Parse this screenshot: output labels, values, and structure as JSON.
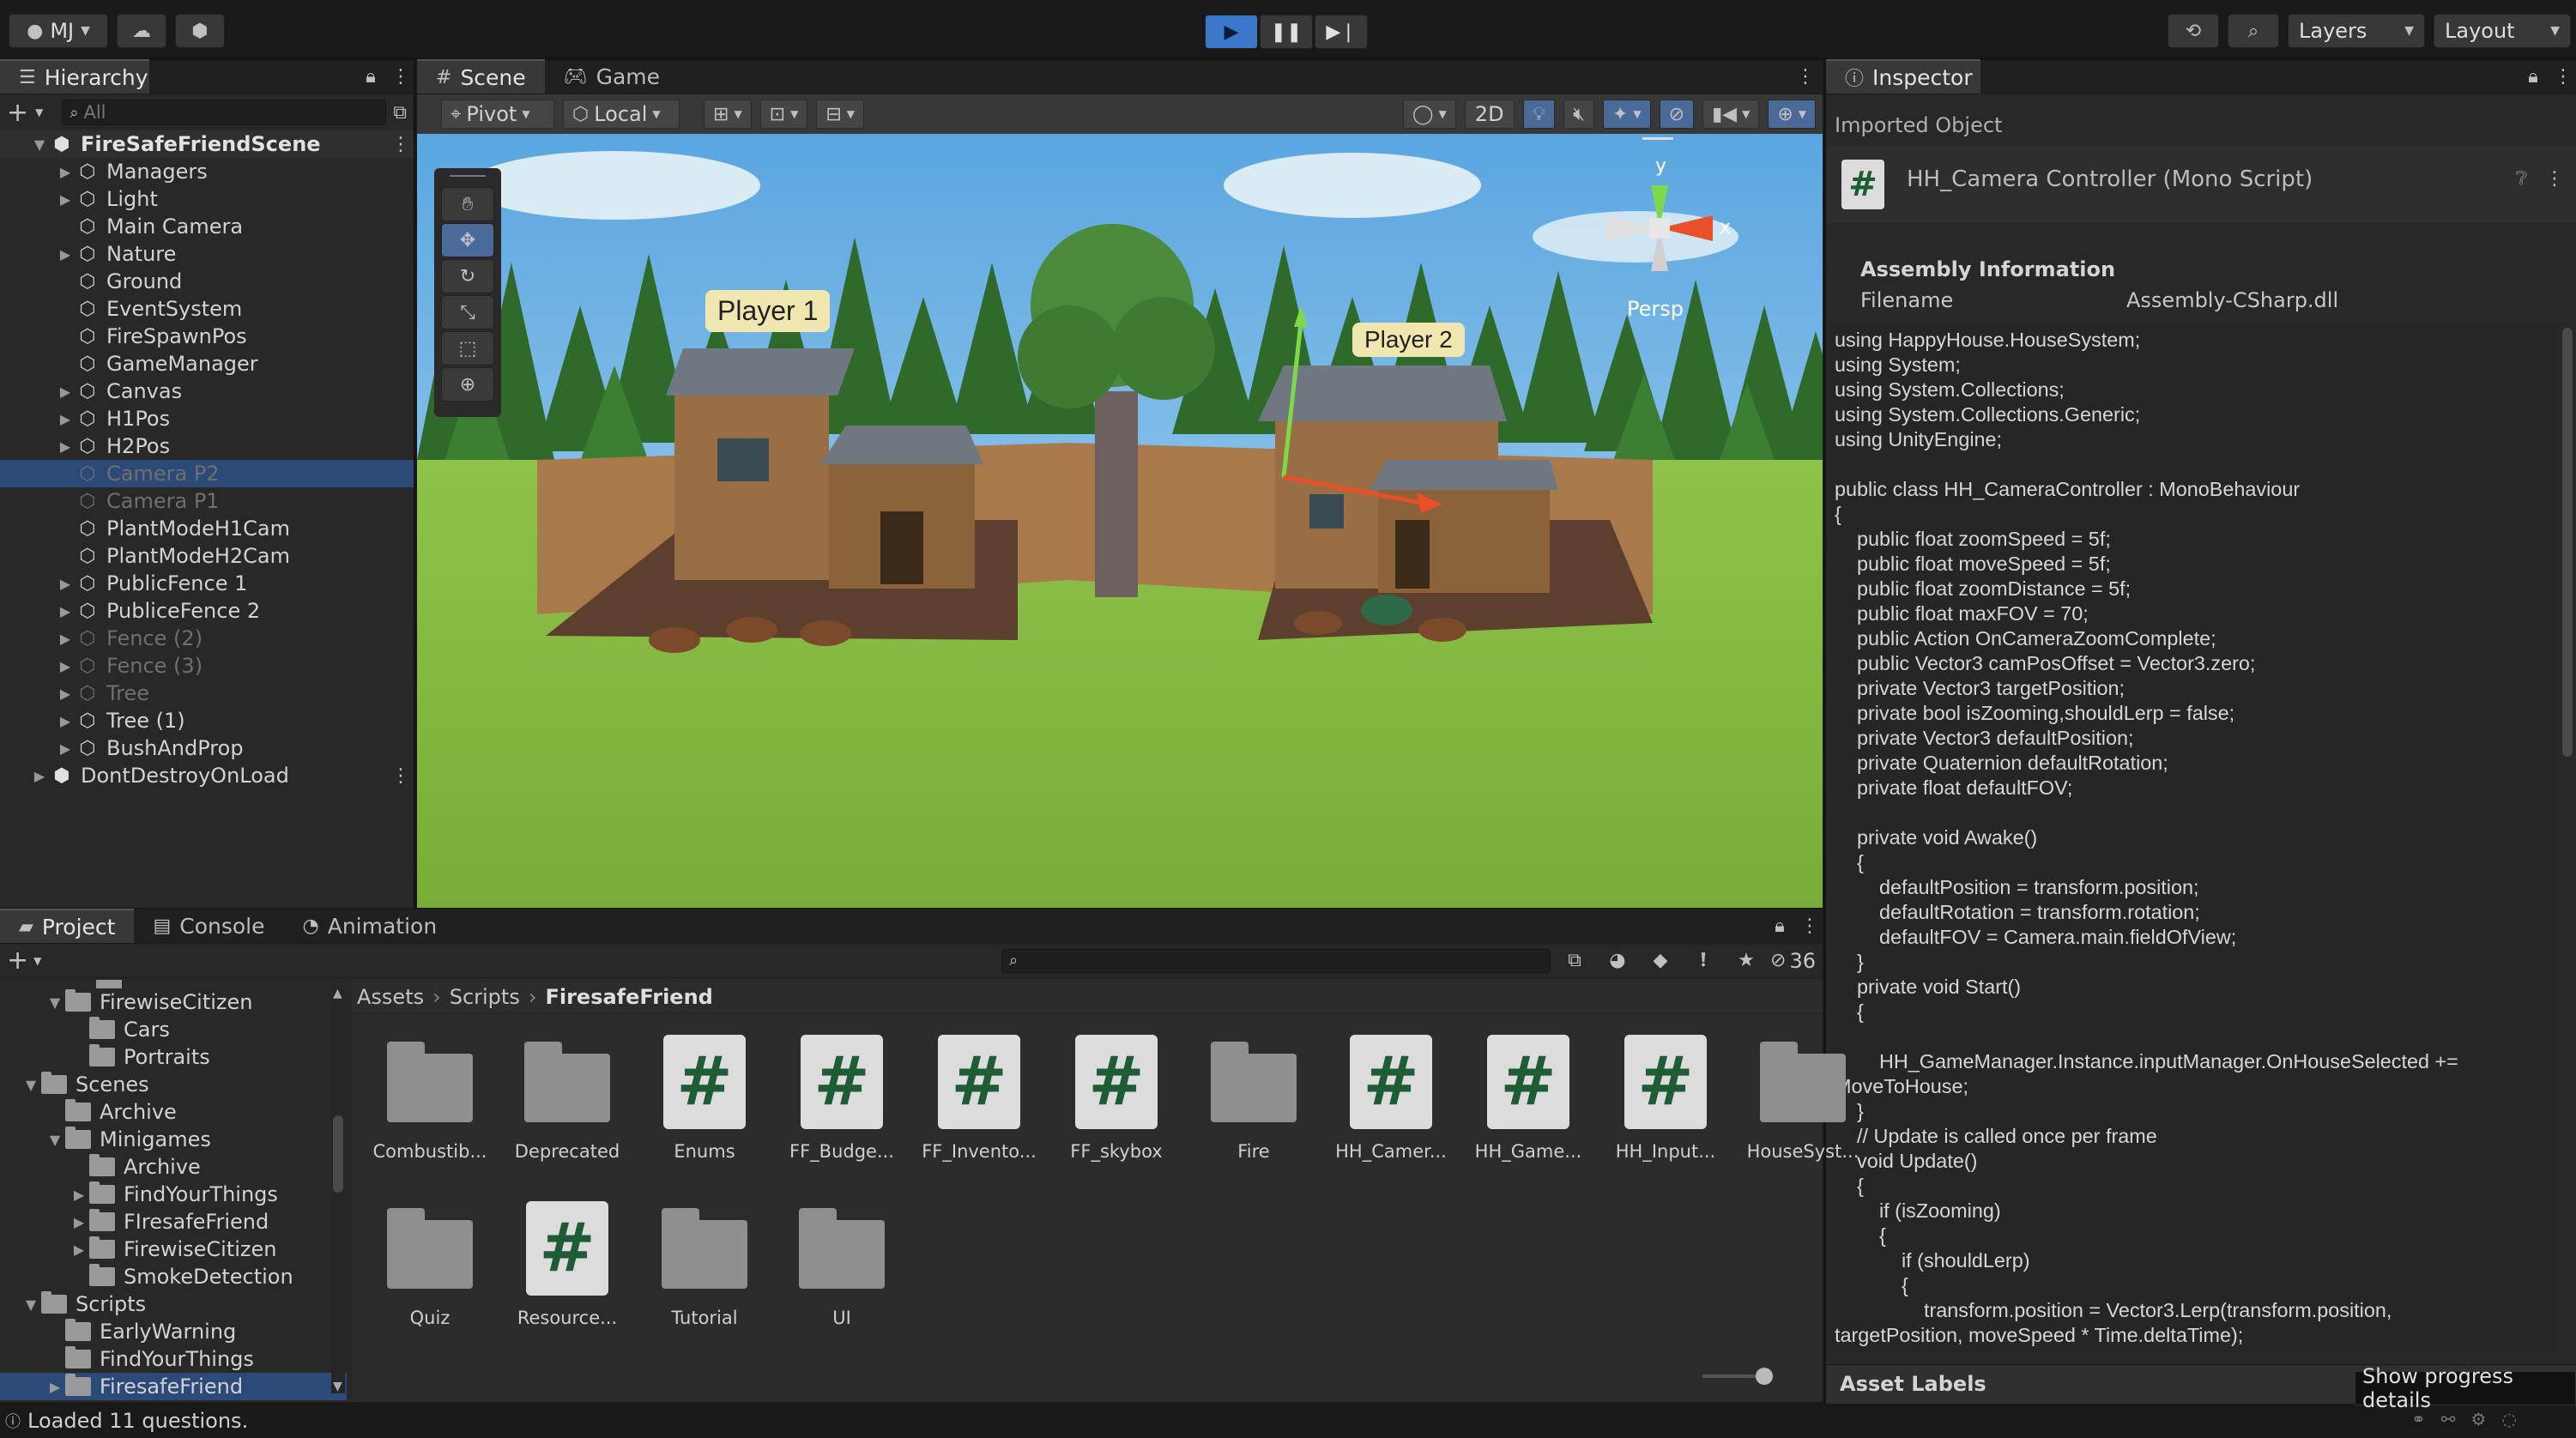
{
  "toolbar": {
    "account": "MJ",
    "layers_label": "Layers",
    "layout_label": "Layout"
  },
  "hierarchy": {
    "tab": "Hierarchy",
    "search_placeholder": "All",
    "scene_name": "FireSafeFriendScene",
    "items": [
      {
        "label": "Managers",
        "arrow": true,
        "dim": false,
        "sel": false
      },
      {
        "label": "Light",
        "arrow": true,
        "dim": false,
        "sel": false
      },
      {
        "label": "Main Camera",
        "arrow": false,
        "dim": false,
        "sel": false
      },
      {
        "label": "Nature",
        "arrow": true,
        "dim": false,
        "sel": false
      },
      {
        "label": "Ground",
        "arrow": false,
        "dim": false,
        "sel": false
      },
      {
        "label": "EventSystem",
        "arrow": false,
        "dim": false,
        "sel": false
      },
      {
        "label": "FireSpawnPos",
        "arrow": false,
        "dim": false,
        "sel": false
      },
      {
        "label": "GameManager",
        "arrow": false,
        "dim": false,
        "sel": false
      },
      {
        "label": "Canvas",
        "arrow": true,
        "dim": false,
        "sel": false
      },
      {
        "label": "H1Pos",
        "arrow": true,
        "dim": false,
        "sel": false
      },
      {
        "label": "H2Pos",
        "arrow": true,
        "dim": false,
        "sel": false
      },
      {
        "label": "Camera P2",
        "arrow": false,
        "dim": true,
        "sel": true
      },
      {
        "label": "Camera P1",
        "arrow": false,
        "dim": true,
        "sel": false
      },
      {
        "label": "PlantModeH1Cam",
        "arrow": false,
        "dim": false,
        "sel": false
      },
      {
        "label": "PlantModeH2Cam",
        "arrow": false,
        "dim": false,
        "sel": false
      },
      {
        "label": "PublicFence 1",
        "arrow": true,
        "dim": false,
        "sel": false
      },
      {
        "label": "PubliceFence 2",
        "arrow": true,
        "dim": false,
        "sel": false
      },
      {
        "label": "Fence (2)",
        "arrow": true,
        "dim": true,
        "sel": false
      },
      {
        "label": "Fence (3)",
        "arrow": true,
        "dim": true,
        "sel": false
      },
      {
        "label": "Tree",
        "arrow": true,
        "dim": true,
        "sel": false
      },
      {
        "label": "Tree (1)",
        "arrow": true,
        "dim": false,
        "sel": false
      },
      {
        "label": "BushAndProp",
        "arrow": true,
        "dim": false,
        "sel": false
      }
    ],
    "dont_destroy": "DontDestroyOnLoad"
  },
  "scene": {
    "tab_scene": "Scene",
    "tab_game": "Game",
    "pivot": "Pivot",
    "local": "Local",
    "mode_2d": "2D",
    "persp": "Persp",
    "player1": "Player 1",
    "player2": "Player 2",
    "axis_x": "x",
    "axis_y": "y"
  },
  "inspector": {
    "tab": "Inspector",
    "imported": "Imported Object",
    "object_title": "HH_Camera Controller (Mono Script)",
    "assembly_header": "Assembly Information",
    "filename_label": "Filename",
    "filename_value": "Assembly-CSharp.dll",
    "code": "using HappyHouse.HouseSystem;\nusing System;\nusing System.Collections;\nusing System.Collections.Generic;\nusing UnityEngine;\n\npublic class HH_CameraController : MonoBehaviour\n{\n    public float zoomSpeed = 5f;\n    public float moveSpeed = 5f;\n    public float zoomDistance = 5f;\n    public float maxFOV = 70;\n    public Action OnCameraZoomComplete;\n    public Vector3 camPosOffset = Vector3.zero;\n    private Vector3 targetPosition;\n    private bool isZooming,shouldLerp = false;\n    private Vector3 defaultPosition;\n    private Quaternion defaultRotation;\n    private float defaultFOV;\n\n    private void Awake()\n    {\n        defaultPosition = transform.position;\n        defaultRotation = transform.rotation;\n        defaultFOV = Camera.main.fieldOfView;\n    }\n    private void Start()\n    {\n\n        HH_GameManager.Instance.inputManager.OnHouseSelected +=\nMoveToHouse;\n    }\n    // Update is called once per frame\n    void Update()\n    {\n        if (isZooming)\n        {\n            if (shouldLerp)\n            {\n                transform.position = Vector3.Lerp(transform.position,\ntargetPosition, moveSpeed * Time.deltaTime);",
    "asset_labels": "Asset Labels"
  },
  "project": {
    "tab_project": "Project",
    "tab_console": "Console",
    "tab_animation": "Animation",
    "hidden_count": "36",
    "tree": [
      {
        "label": "FirewiseCitizen",
        "indent": 2,
        "arrow": "▼"
      },
      {
        "label": "Cars",
        "indent": 3,
        "arrow": ""
      },
      {
        "label": "Portraits",
        "indent": 3,
        "arrow": ""
      },
      {
        "label": "Scenes",
        "indent": 1,
        "arrow": "▼"
      },
      {
        "label": "Archive",
        "indent": 2,
        "arrow": ""
      },
      {
        "label": "Minigames",
        "indent": 2,
        "arrow": "▼"
      },
      {
        "label": "Archive",
        "indent": 3,
        "arrow": ""
      },
      {
        "label": "FindYourThings",
        "indent": 3,
        "arrow": "▶"
      },
      {
        "label": "FIresafeFriend",
        "indent": 3,
        "arrow": "▶"
      },
      {
        "label": "FirewiseCitizen",
        "indent": 3,
        "arrow": "▶"
      },
      {
        "label": "SmokeDetection",
        "indent": 3,
        "arrow": ""
      },
      {
        "label": "Scripts",
        "indent": 1,
        "arrow": "▼"
      },
      {
        "label": "EarlyWarning",
        "indent": 2,
        "arrow": ""
      },
      {
        "label": "FindYourThings",
        "indent": 2,
        "arrow": ""
      },
      {
        "label": "FiresafeFriend",
        "indent": 2,
        "arrow": "▶"
      }
    ],
    "breadcrumb": [
      "Assets",
      "Scripts",
      "FiresafeFriend"
    ],
    "assets": [
      {
        "label": "Combustib...",
        "type": "folder"
      },
      {
        "label": "Deprecated",
        "type": "folder"
      },
      {
        "label": "Enums",
        "type": "script"
      },
      {
        "label": "FF_Budge...",
        "type": "script"
      },
      {
        "label": "FF_Invento...",
        "type": "script"
      },
      {
        "label": "FF_skybox",
        "type": "script"
      },
      {
        "label": "Fire",
        "type": "folder"
      },
      {
        "label": "HH_Camer...",
        "type": "script"
      },
      {
        "label": "HH_Game...",
        "type": "script"
      },
      {
        "label": "HH_Input...",
        "type": "script"
      },
      {
        "label": "HouseSyst...",
        "type": "folder"
      },
      {
        "label": "Quiz",
        "type": "folder"
      },
      {
        "label": "Resource...",
        "type": "script"
      },
      {
        "label": "Tutorial",
        "type": "folder"
      },
      {
        "label": "UI",
        "type": "folder"
      }
    ]
  },
  "status": {
    "message": "Loaded 11 questions.",
    "progress_tooltip": "Show progress details"
  }
}
